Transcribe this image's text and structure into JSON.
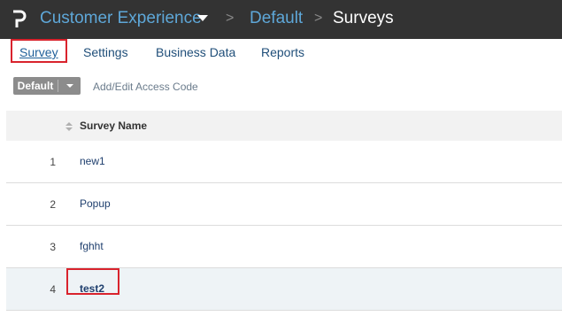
{
  "header": {
    "logo_icon": "p-logo-icon",
    "app_name": "Customer Experience",
    "separator": ">",
    "breadcrumb_default": "Default",
    "breadcrumb_current": "Surveys"
  },
  "tabs": [
    {
      "label": "Survey",
      "active": true
    },
    {
      "label": "Settings"
    },
    {
      "label": "Business Data"
    },
    {
      "label": "Reports"
    }
  ],
  "toolbar": {
    "access_code_select": "Default",
    "access_code_link": "Add/Edit Access Code"
  },
  "table": {
    "columns": [
      "",
      "Survey Name"
    ],
    "rows": [
      {
        "num": "1",
        "name": "new1"
      },
      {
        "num": "2",
        "name": "Popup"
      },
      {
        "num": "3",
        "name": "fghht"
      },
      {
        "num": "4",
        "name": "test2"
      }
    ]
  },
  "colors": {
    "topbar": "#333333",
    "link": "#5ea7d8",
    "highlight_box": "#d9232d",
    "row_highlight": "#eef3f6"
  }
}
